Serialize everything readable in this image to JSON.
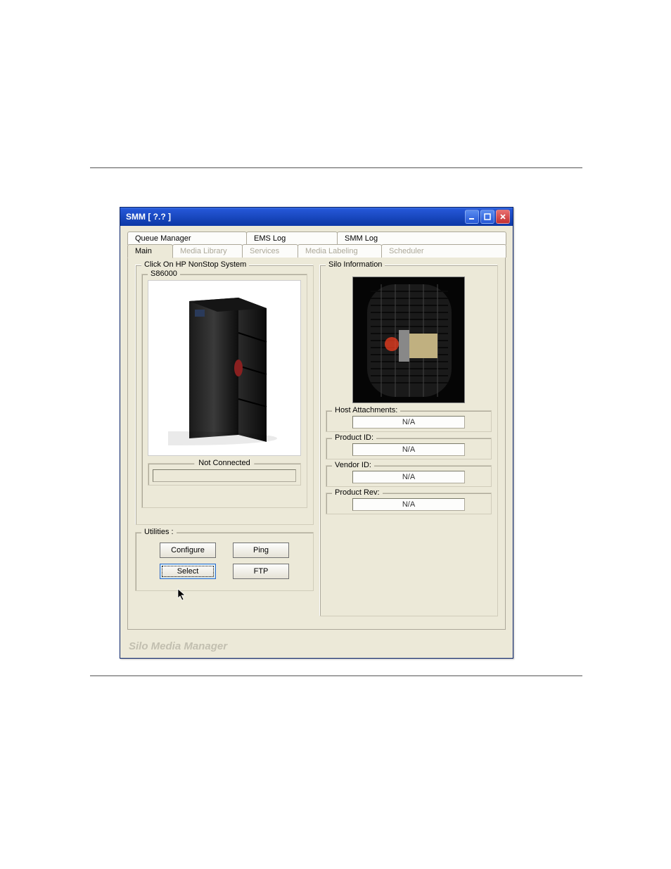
{
  "title": "SMM [ ?.? ]",
  "tabs_row1": [
    {
      "id": "queue-manager",
      "label": "Queue Manager"
    },
    {
      "id": "ems-log",
      "label": "EMS Log"
    },
    {
      "id": "smm-log",
      "label": "SMM Log"
    }
  ],
  "tabs_row2": [
    {
      "id": "main",
      "label": "Main",
      "active": true
    },
    {
      "id": "media-library",
      "label": "Media Library"
    },
    {
      "id": "services",
      "label": "Services"
    },
    {
      "id": "media-labeling",
      "label": "Media Labeling"
    },
    {
      "id": "scheduler",
      "label": "Scheduler"
    }
  ],
  "left": {
    "hp_group_label": "Click On HP NonStop System",
    "system_label": "S86000",
    "status_label": "Not Connected",
    "utilities_label": "Utilities :",
    "buttons": {
      "configure": "Configure",
      "ping": "Ping",
      "select": "Select",
      "ftp": "FTP"
    }
  },
  "right": {
    "group_label": "Silo Information",
    "host_attachments": {
      "label": "Host Attachments:",
      "value": "N/A"
    },
    "product_id": {
      "label": "Product ID:",
      "value": "N/A"
    },
    "vendor_id": {
      "label": "Vendor ID:",
      "value": "N/A"
    },
    "product_rev": {
      "label": "Product Rev:",
      "value": "N/A"
    }
  },
  "footer": "Silo Media Manager"
}
